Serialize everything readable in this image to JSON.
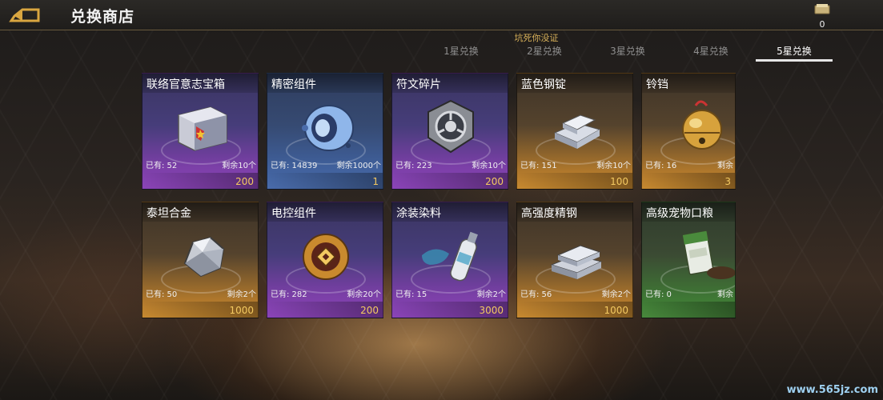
{
  "header": {
    "title": "兑换商店",
    "currency_count": "0"
  },
  "subtitle": "坑死你没证",
  "tabs": [
    {
      "label": "1星兑换",
      "active": false
    },
    {
      "label": "2星兑换",
      "active": false
    },
    {
      "label": "3星兑换",
      "active": false
    },
    {
      "label": "4星兑换",
      "active": false
    },
    {
      "label": "5星兑换",
      "active": true
    }
  ],
  "items": [
    {
      "name": "联络官意志宝箱",
      "own": "已有: 52",
      "remaining": "剩余10个",
      "cost": "200",
      "rarity": "purple",
      "icon": "treasure-chest-icon"
    },
    {
      "name": "精密组件",
      "own": "已有: 14839",
      "remaining": "剩余1000个",
      "cost": "1",
      "rarity": "blue",
      "icon": "precision-component-icon"
    },
    {
      "name": "符文碎片",
      "own": "已有: 223",
      "remaining": "剩余10个",
      "cost": "200",
      "rarity": "purple",
      "icon": "rune-fragment-icon"
    },
    {
      "name": "蓝色钢锭",
      "own": "已有: 151",
      "remaining": "剩余10个",
      "cost": "100",
      "rarity": "gold",
      "icon": "steel-ingot-icon"
    },
    {
      "name": "铃铛",
      "own": "已有: 16",
      "remaining": "剩余",
      "cost": "3",
      "rarity": "gold",
      "icon": "bell-icon"
    },
    {
      "name": "泰坦合金",
      "own": "已有: 50",
      "remaining": "剩余2个",
      "cost": "1000",
      "rarity": "gold",
      "icon": "titan-alloy-icon"
    },
    {
      "name": "电控组件",
      "own": "已有: 282",
      "remaining": "剩余20个",
      "cost": "200",
      "rarity": "purple",
      "icon": "electric-component-icon"
    },
    {
      "name": "涂装染料",
      "own": "已有: 15",
      "remaining": "剩余2个",
      "cost": "3000",
      "rarity": "purple",
      "icon": "spray-paint-icon"
    },
    {
      "name": "高强度精钢",
      "own": "已有: 56",
      "remaining": "剩余2个",
      "cost": "1000",
      "rarity": "gold",
      "icon": "refined-steel-icon"
    },
    {
      "name": "高级宠物口粮",
      "own": "已有: 0",
      "remaining": "剩余",
      "cost": "",
      "rarity": "green",
      "icon": "pet-food-icon"
    }
  ],
  "watermark": "www.565jz.com"
}
